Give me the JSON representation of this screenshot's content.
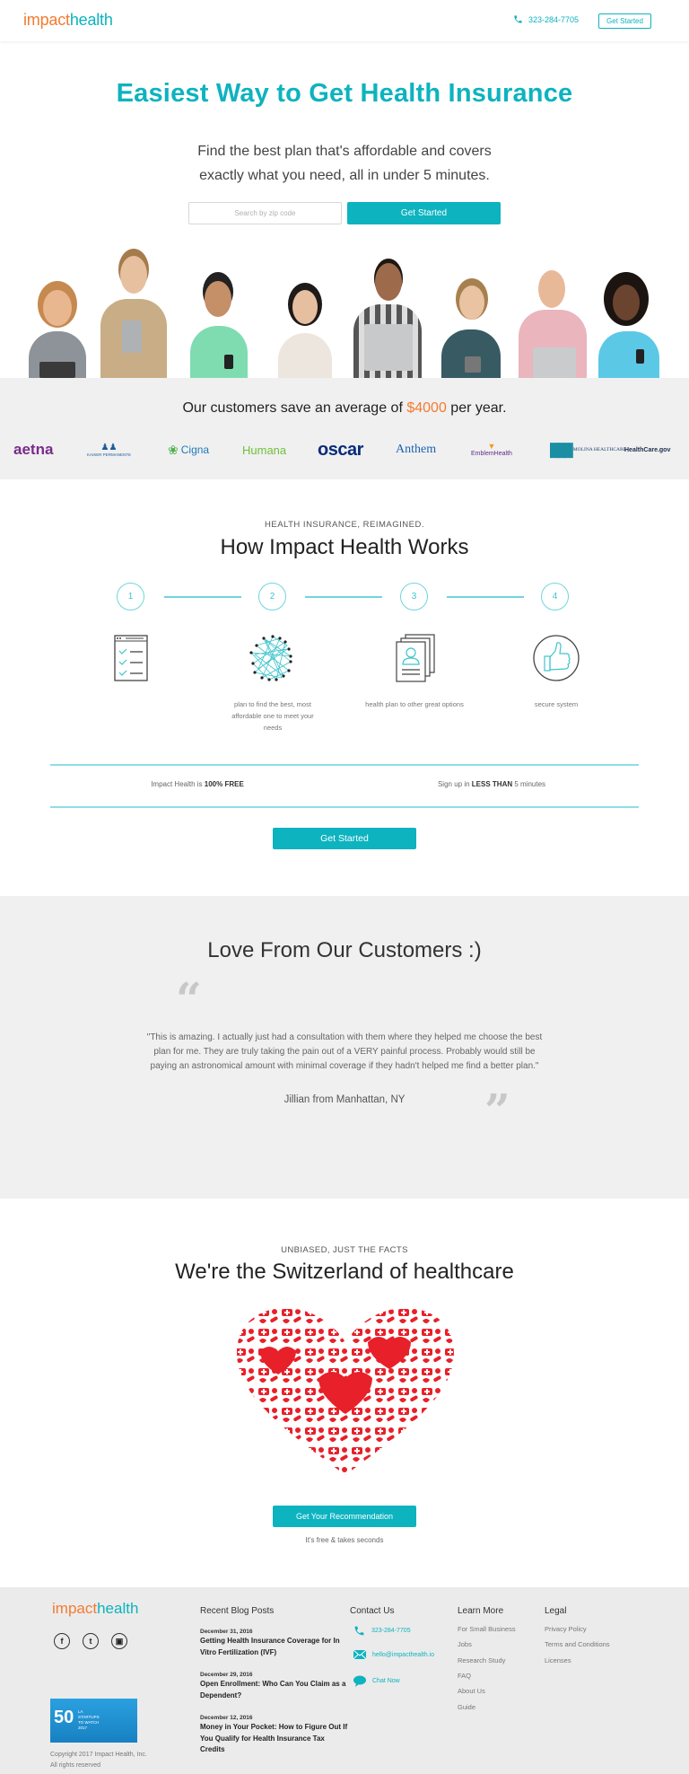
{
  "header": {
    "logo_part1": "impact",
    "logo_part2": "health",
    "phone": "323-284-7705",
    "cta_label": "Get Started"
  },
  "hero": {
    "title": "Easiest Way to Get Health Insurance",
    "subtitle_line1": "Find the best plan that's affordable and covers",
    "subtitle_line2": "exactly what you need, all in under 5 minutes.",
    "zip_placeholder": "Search by zip code",
    "zip_value": "",
    "cta_label": "Get Started"
  },
  "savings": {
    "prefix": "Our customers save an average of ",
    "amount": "$4000",
    "suffix": " per year.",
    "insurers": [
      "aetna",
      "KAISER PERMANENTE",
      "Cigna",
      "Humana",
      "oscar",
      "Anthem",
      "EmblemHealth",
      "MOLINA HEALTHCARE",
      "HealthCare.gov"
    ]
  },
  "how": {
    "eyebrow": "HEALTH INSURANCE, REIMAGINED.",
    "title": "How Impact Health Works",
    "steps": [
      {
        "number": "1",
        "icon": "checklist-icon",
        "caption": ""
      },
      {
        "number": "2",
        "icon": "network-icon",
        "caption": "plan to find the best, most affordable one to meet your needs"
      },
      {
        "number": "3",
        "icon": "documents-icon",
        "caption": "health plan to other great options"
      },
      {
        "number": "4",
        "icon": "thumbs-up-icon",
        "caption": "secure system"
      }
    ],
    "free_prefix": "Impact Health is ",
    "free_bold": "100% FREE",
    "fast_prefix": "Sign up in ",
    "fast_bold": "LESS THAN",
    "fast_suffix": " 5 minutes",
    "cta_label": "Get Started"
  },
  "testimonials": {
    "title": "Love From Our Customers :)",
    "open_quote": "“",
    "close_quote": "”",
    "quote": "\"This is amazing. I actually just had a consultation with them where they helped me choose the best plan for me. They are truly taking the pain out of a VERY painful process. Probably would still be paying an astronomical amount with minimal coverage if they hadn't helped me find a better plan.\"",
    "author": "Jillian from Manhattan, NY"
  },
  "switzerland": {
    "eyebrow": "UNBIASED, JUST THE FACTS",
    "title": "We're the Switzerland of healthcare",
    "cta_label": "Get Your Recommendation",
    "cta_sub": "It's free & takes seconds"
  },
  "footer": {
    "logo_part1": "impact",
    "logo_part2": "health",
    "social": [
      {
        "icon": "facebook-icon",
        "glyph": "f"
      },
      {
        "icon": "twitter-icon",
        "glyph": "t"
      },
      {
        "icon": "instagram-icon",
        "glyph": "▣"
      }
    ],
    "badge_number": "50",
    "badge_text": "LA STARTUPS TO WATCH 2017",
    "copyright_line1": "Copyright 2017 Impact Health, Inc.",
    "copyright_line2": "All rights reserved",
    "blog": {
      "heading": "Recent Blog Posts",
      "posts": [
        {
          "date": "December 31, 2016",
          "title": "Getting Health Insurance Coverage for In Vitro Fertilization (IVF)"
        },
        {
          "date": "December 29, 2016",
          "title": "Open Enrollment: Who Can You Claim as a Dependent?"
        },
        {
          "date": "December 12, 2016",
          "title": "Money in Your Pocket: How to Figure Out If You Qualify for Health Insurance Tax Credits"
        }
      ]
    },
    "contact": {
      "heading": "Contact Us",
      "phone": "323-284-7705",
      "email": "hello@impacthealth.io",
      "chat": "Chat Now"
    },
    "learn": {
      "heading": "Learn More",
      "links": [
        "For Small Business",
        "Jobs",
        "Research Study",
        "FAQ",
        "About Us",
        "Guide"
      ]
    },
    "legal": {
      "heading": "Legal",
      "links": [
        "Privacy Policy",
        "Terms and Conditions",
        "Licenses"
      ]
    }
  },
  "colors": {
    "brand_teal": "#0db3bf",
    "brand_orange": "#f47b30",
    "heart_red": "#e8202a",
    "section_gray": "#f0f0f0"
  }
}
